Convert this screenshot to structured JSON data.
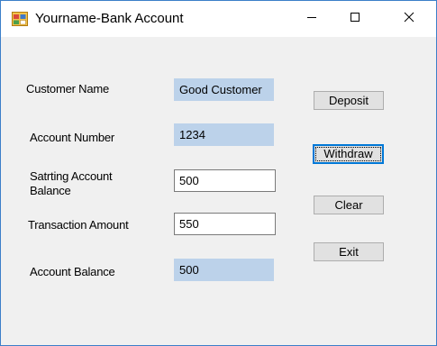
{
  "window": {
    "title": "Yourname-Bank Account",
    "controls": {
      "minimize_icon": "minimize-icon",
      "maximize_icon": "maximize-icon",
      "close_icon": "close-icon"
    },
    "accent_color": "#0078d7"
  },
  "form": {
    "customer_name": {
      "label": "Customer Name",
      "value": "Good Customer"
    },
    "account_number": {
      "label": "Account Number",
      "value": "1234"
    },
    "starting_balance": {
      "label_line1": "Satrting Account",
      "label_line2": "Balance",
      "value": "500"
    },
    "transaction_amount": {
      "label": "Transaction Amount",
      "value": "550"
    },
    "account_balance": {
      "label": "Account Balance",
      "value": "500"
    }
  },
  "buttons": {
    "deposit": "Deposit",
    "withdraw": "Withdraw",
    "clear": "Clear",
    "exit": "Exit"
  }
}
